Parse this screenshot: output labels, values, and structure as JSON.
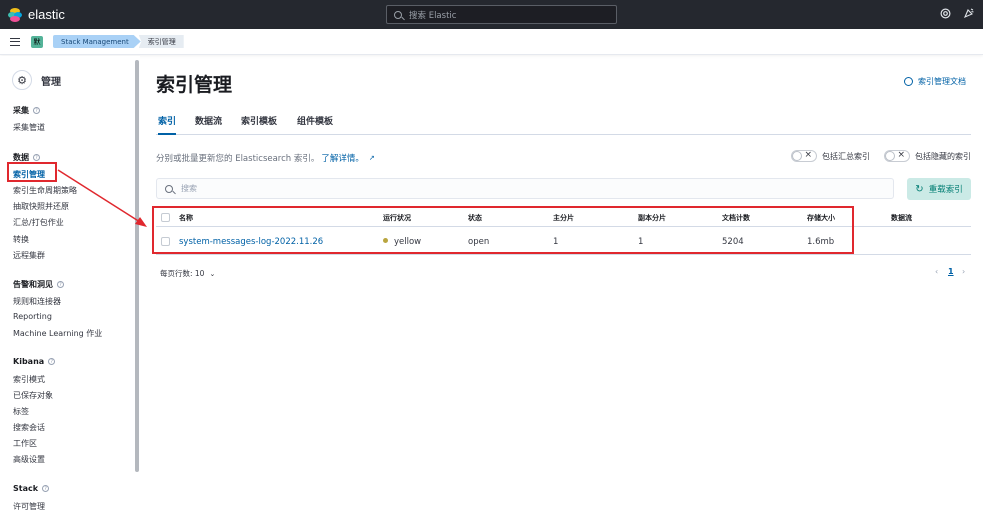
{
  "header": {
    "logo_text": "elastic",
    "search_placeholder": "搜索 Elastic",
    "icons": [
      "help-icon",
      "newsfeed-icon"
    ],
    "logo_colors": [
      "#f0bf1a",
      "#3ebeb0",
      "#07a5de",
      "#ee5097",
      "#17a8e0"
    ]
  },
  "breadcrumbs": {
    "space_initial": "默",
    "items": [
      "Stack Management",
      "索引管理"
    ]
  },
  "sidebar": {
    "title": "管理",
    "groups": [
      {
        "label": "采集",
        "items": [
          "采集管道"
        ]
      },
      {
        "label": "数据",
        "items": [
          "索引管理",
          "索引生命周期策略",
          "抽取快照并还原",
          "汇总/打包作业",
          "转换",
          "远程集群"
        ]
      },
      {
        "label": "告警和洞见",
        "items": [
          "规则和连接器",
          "Reporting",
          "Machine Learning 作业"
        ]
      },
      {
        "label": "Kibana",
        "items": [
          "索引模式",
          "已保存对象",
          "标签",
          "搜索会话",
          "工作区",
          "高级设置"
        ]
      },
      {
        "label": "Stack",
        "items": [
          "许可管理"
        ]
      }
    ],
    "info_glyph": "?"
  },
  "main": {
    "title": "索引管理",
    "docs_link": "索引管理文档",
    "tabs": [
      "索引",
      "数据流",
      "索引模板",
      "组件模板"
    ],
    "description": "分别或批量更新您的 Elasticsearch 索引。",
    "learn_more": "了解详情。",
    "toggles": [
      "包括汇总索引",
      "包括隐藏的索引"
    ],
    "search_placeholder": "搜索",
    "reload_button": "重载索引",
    "table": {
      "columns": [
        "名称",
        "运行状况",
        "状态",
        "主分片",
        "副本分片",
        "文档计数",
        "存储大小",
        "数据流"
      ],
      "rows": [
        {
          "name": "system-messages-log-2022.11.26",
          "health": "yellow",
          "status": "open",
          "primaries": "1",
          "replicas": "1",
          "docs_count": "5204",
          "storage_size": "1.6mb",
          "data_stream": ""
        }
      ]
    },
    "rows_per_page": "每页行数: 10",
    "pagination": {
      "prev": "‹",
      "current": "1",
      "next": "›"
    }
  },
  "colors": {
    "accent": "#0061a6",
    "annotation": "#e0282e",
    "health_yellow": "#b9a53f",
    "reload_bg": "#cbeae6"
  }
}
